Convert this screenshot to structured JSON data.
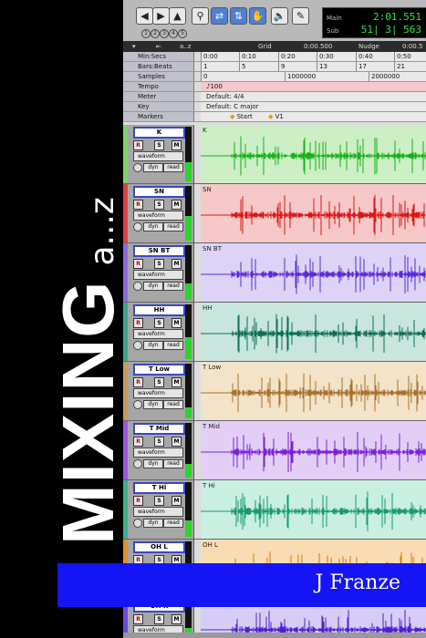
{
  "cover": {
    "title": "MIXING",
    "subtitle": "a...z",
    "author": "J Franze"
  },
  "counter": {
    "main_label": "Main",
    "main_value": "2:01.551",
    "sub_label": "Sub",
    "sub_value": "51| 3| 563"
  },
  "toolbar": {
    "grid_label": "Grid",
    "grid_value": "0:00.500",
    "nudge_label": "Nudge",
    "nudge_value": "0:00.5",
    "counter_nums": "1 2 3 4 5"
  },
  "rulers": [
    {
      "label": "Min:Secs",
      "ticks": [
        "0:00",
        "0:10",
        "0:20",
        "0:30",
        "0:40",
        "0:50"
      ]
    },
    {
      "label": "Bars:Beats",
      "ticks": [
        "1",
        "5",
        "9",
        "13",
        "17",
        "21"
      ]
    },
    {
      "label": "Samples",
      "ticks": [
        "0",
        "1000000",
        "2000000"
      ]
    },
    {
      "label": "Tempo",
      "content": "♪100"
    },
    {
      "label": "Meter",
      "content": "Default: 4/4"
    },
    {
      "label": "Key",
      "content": "Default: C major"
    },
    {
      "label": "Markers",
      "markers": [
        "Start",
        "V1"
      ]
    }
  ],
  "track_controls": {
    "rec": "R",
    "solo": "S",
    "mute": "M",
    "view": "waveform",
    "dyn": "dyn",
    "read": "read"
  },
  "tracks": [
    {
      "name": "K",
      "color": "#7dd16a",
      "lane_bg": "#ccefc6",
      "wave": "#16b216",
      "level": 0.35
    },
    {
      "name": "SN",
      "color": "#e04040",
      "lane_bg": "#f6c8c8",
      "wave": "#d81818",
      "level": 0.45
    },
    {
      "name": "SN BT",
      "color": "#8a6ae0",
      "lane_bg": "#dcd3f6",
      "wave": "#5a2cd6",
      "level": 0.3
    },
    {
      "name": "HH",
      "color": "#3aa68a",
      "lane_bg": "#c8e6dd",
      "wave": "#0e6e52",
      "level": 0.4
    },
    {
      "name": "T Low",
      "color": "#c89a56",
      "lane_bg": "#f3e3c9",
      "wave": "#a8702a",
      "level": 0.2
    },
    {
      "name": "T Mid",
      "color": "#9a56e0",
      "lane_bg": "#e3cff6",
      "wave": "#7a22d6",
      "level": 0.25
    },
    {
      "name": "T Hi",
      "color": "#3ab08a",
      "lane_bg": "#c8efe0",
      "wave": "#1a9a6e",
      "level": 0.3
    },
    {
      "name": "OH L",
      "color": "#e0902a",
      "lane_bg": "#f8dcb3",
      "wave": "#d47a0c",
      "level": 0.5
    },
    {
      "name": "OH R",
      "color": "#6a4ae0",
      "lane_bg": "#d6cdf6",
      "wave": "#5020d0",
      "level": 0.5
    }
  ]
}
